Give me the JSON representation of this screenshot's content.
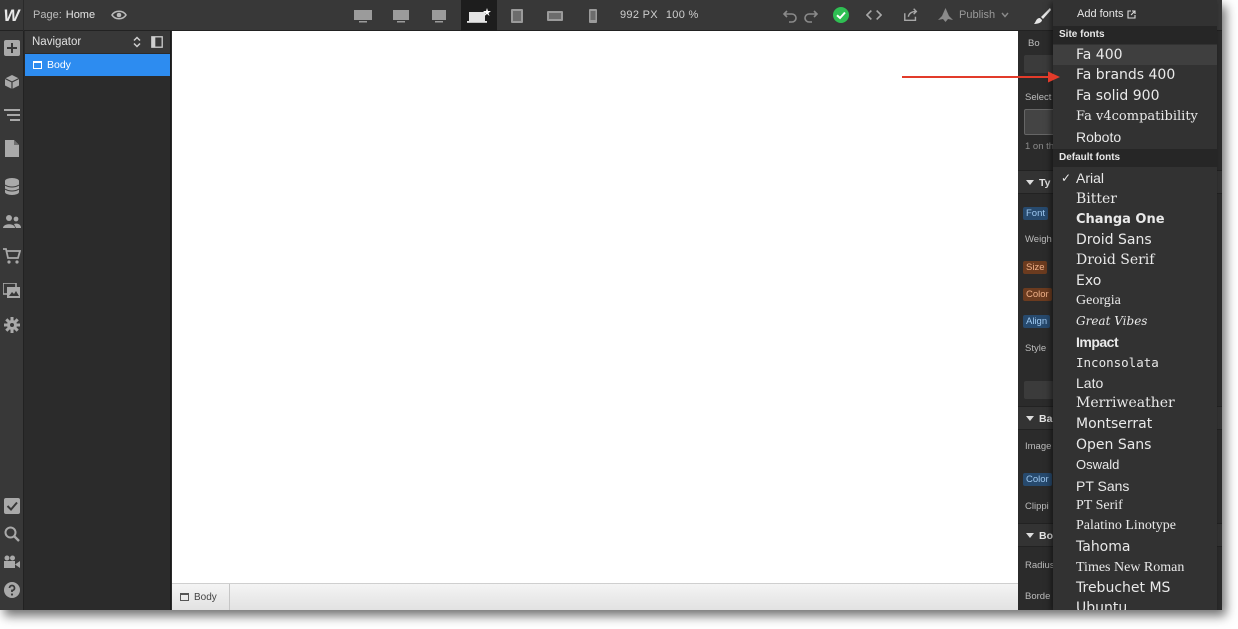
{
  "topbar": {
    "page_prefix": "Page:",
    "page_name": "Home",
    "width_readout": "992 PX",
    "zoom_readout": "100 %",
    "publish_label": "Publish"
  },
  "navigator": {
    "title": "Navigator",
    "items": [
      {
        "label": "Body"
      }
    ]
  },
  "breadcrumb": {
    "item": "Body"
  },
  "panel": {
    "labels": {
      "body": "Bo",
      "selector": "Select",
      "on_this": "1 on th",
      "typography": "Ty",
      "font": "Font",
      "weight": "Weigh",
      "size": "Size",
      "color": "Color",
      "align": "Align",
      "style": "Style",
      "backgrounds": "Ba",
      "image": "Image",
      "bg_color": "Color",
      "clipping": "Clippi",
      "borders": "Bo",
      "radius": "Radius",
      "border": "Borde"
    }
  },
  "font_dropdown": {
    "add_fonts": "Add fonts",
    "site_fonts_heading": "Site fonts",
    "site_fonts": [
      "Fa 400",
      "Fa brands 400",
      "Fa solid 900",
      "Fa v4compatibility",
      "Roboto"
    ],
    "default_fonts_heading": "Default fonts",
    "selected": "Arial",
    "default_fonts": [
      "Arial",
      "Bitter",
      "Changa One",
      "Droid Sans",
      "Droid Serif",
      "Exo",
      "Georgia",
      "Great Vibes",
      "Impact",
      "Inconsolata",
      "Lato",
      "Merriweather",
      "Montserrat",
      "Open Sans",
      "Oswald",
      "PT Sans",
      "PT Serif",
      "Palatino Linotype",
      "Tahoma",
      "Times New Roman",
      "Trebuchet MS",
      "Ubuntu"
    ]
  },
  "colors": {
    "accent_blue": "#2d8cf0",
    "success_green": "#2fbf53",
    "annotation_red": "#e23b2a"
  }
}
